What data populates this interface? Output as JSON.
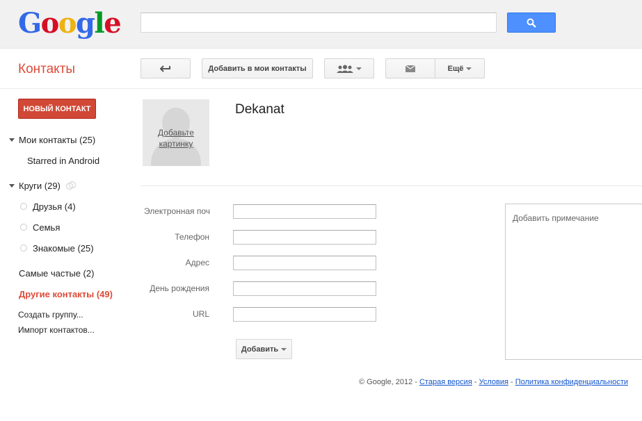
{
  "header": {
    "logo_letters": [
      {
        "ch": "G",
        "color": "#3369e8"
      },
      {
        "ch": "o",
        "color": "#d50f25"
      },
      {
        "ch": "o",
        "color": "#eeb211"
      },
      {
        "ch": "g",
        "color": "#3369e8"
      },
      {
        "ch": "l",
        "color": "#009925"
      },
      {
        "ch": "e",
        "color": "#d50f25"
      }
    ],
    "search_value": "",
    "search_icon": "search-icon"
  },
  "toolbar": {
    "app_title": "Контакты",
    "back_icon": "back-arrow-icon",
    "add_to_contacts": "Добавить в мои контакты",
    "circles_icon": "people-icon",
    "email_icon": "envelope-icon",
    "more": "Ещё"
  },
  "sidebar": {
    "new_contact": "НОВЫЙ КОНТАКТ",
    "my_contacts": "Мои контакты (25)",
    "starred": "Starred in Android",
    "circles": "Круги (29)",
    "circle_items": [
      "Друзья (4)",
      "Семья",
      "Знакомые (25)"
    ],
    "frequent": "Самые частые (2)",
    "other_contacts": "Другие контакты (49)",
    "create_group": "Создать группу...",
    "import": "Импорт контактов..."
  },
  "contact": {
    "add_picture": "Добавьте картинку",
    "name": "Dekanat",
    "fields": [
      {
        "label": "Электронная почта",
        "value": ""
      },
      {
        "label": "Телефон",
        "value": ""
      },
      {
        "label": "Адрес",
        "value": ""
      },
      {
        "label": "День рождения",
        "value": ""
      },
      {
        "label": "URL",
        "value": ""
      }
    ],
    "add_button": "Добавить",
    "note_placeholder": "Добавить примечание"
  },
  "footer": {
    "copyright": "© Google, 2012 -",
    "old_version": "Старая версия",
    "sep": "-",
    "terms": "Условия",
    "privacy": "Политика конфиденциальности"
  },
  "colors": {
    "accent_red": "#dd4b39",
    "search_blue": "#4d90fe",
    "link_blue": "#15c"
  }
}
